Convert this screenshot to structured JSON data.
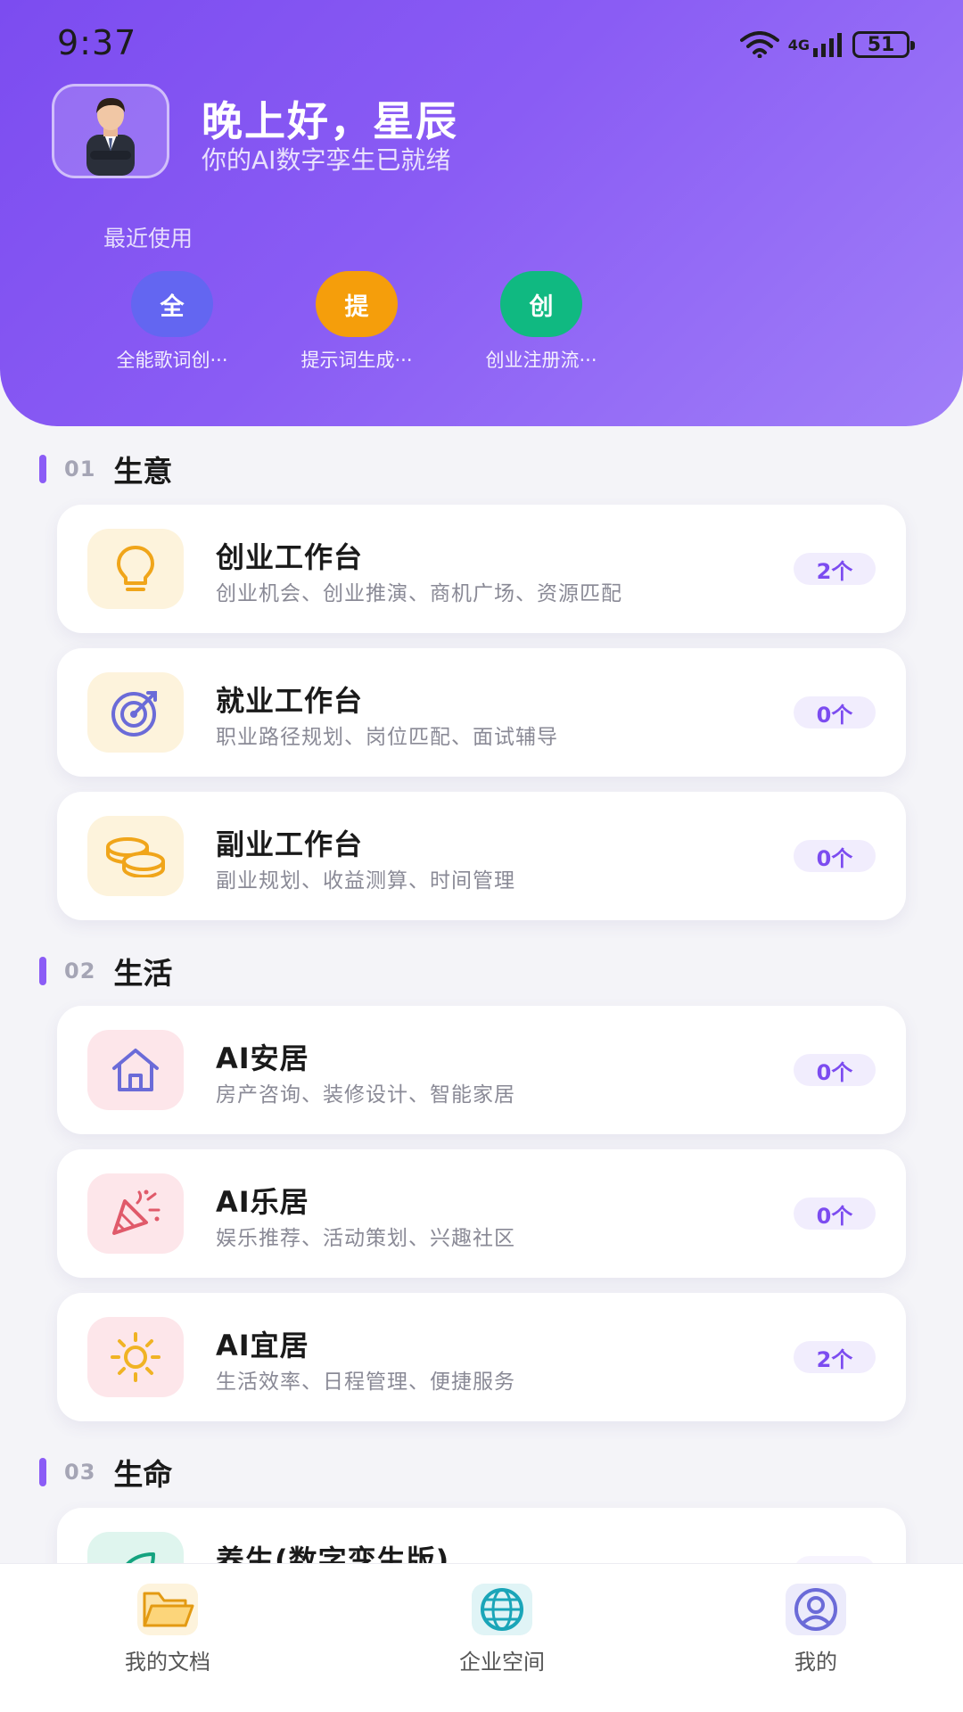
{
  "status_bar": {
    "time": "9:37",
    "network": "4G",
    "battery": "51"
  },
  "header": {
    "greeting": "晚上好，星辰",
    "subtitle": "你的AI数字孪生已就绪",
    "recent_title": "最近使用",
    "recent_items": [
      {
        "char": "全",
        "label": "全能歌词创···",
        "color": "#6366f1"
      },
      {
        "char": "提",
        "label": "提示词生成···",
        "color": "#f59e0b"
      },
      {
        "char": "创",
        "label": "创业注册流···",
        "color": "#10b981"
      }
    ]
  },
  "sections": [
    {
      "num": "01",
      "title": "生意",
      "cards": [
        {
          "title": "创业工作台",
          "desc": "创业机会、创业推演、商机广场、资源匹配",
          "badge": "2个",
          "icon": "lightbulb-icon",
          "icon_bg": "#fdf3dc"
        },
        {
          "title": "就业工作台",
          "desc": "职业路径规划、岗位匹配、面试辅导",
          "badge": "0个",
          "icon": "target-icon",
          "icon_bg": "#fdf3dc"
        },
        {
          "title": "副业工作台",
          "desc": "副业规划、收益测算、时间管理",
          "badge": "0个",
          "icon": "coins-icon",
          "icon_bg": "#fdf3dc"
        }
      ]
    },
    {
      "num": "02",
      "title": "生活",
      "cards": [
        {
          "title": "AI安居",
          "desc": "房产咨询、装修设计、智能家居",
          "badge": "0个",
          "icon": "house-icon",
          "icon_bg": "#fde6ea"
        },
        {
          "title": "AI乐居",
          "desc": "娱乐推荐、活动策划、兴趣社区",
          "badge": "0个",
          "icon": "party-popper-icon",
          "icon_bg": "#fde6ea"
        },
        {
          "title": "AI宜居",
          "desc": "生活效率、日程管理、便捷服务",
          "badge": "2个",
          "icon": "sun-icon",
          "icon_bg": "#fde6ea"
        }
      ]
    },
    {
      "num": "03",
      "title": "生命",
      "cards": [
        {
          "title": "养生(数字孪生版)",
          "desc": "",
          "badge": "",
          "icon": "leaf-icon",
          "icon_bg": "#dff5ee"
        }
      ]
    }
  ],
  "bottom_nav": [
    {
      "label": "我的文档",
      "icon": "folder-icon"
    },
    {
      "label": "企业空间",
      "icon": "globe-icon"
    },
    {
      "label": "我的",
      "icon": "user-icon"
    }
  ]
}
